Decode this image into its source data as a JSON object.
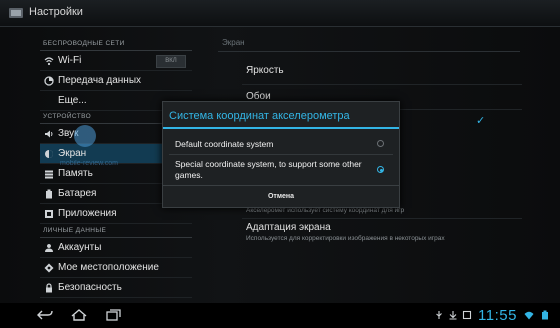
{
  "app": {
    "title": "Настройки"
  },
  "sidebar": {
    "category_wireless": "БЕСПРОВОДНЫЕ СЕТИ",
    "category_device": "УСТРОЙСТВО",
    "category_personal": "ЛИЧНЫЕ ДАННЫЕ",
    "wifi_toggle": "ВКЛ",
    "items": [
      {
        "label": "Wi-Fi",
        "icon": "wifi-icon"
      },
      {
        "label": "Передача данных",
        "icon": "data-usage-icon"
      },
      {
        "label": "Еще...",
        "icon": "more-icon"
      },
      {
        "label": "Звук",
        "icon": "sound-icon"
      },
      {
        "label": "Экран",
        "icon": "display-icon"
      },
      {
        "label": "Память",
        "icon": "storage-icon"
      },
      {
        "label": "Батарея",
        "icon": "battery-icon"
      },
      {
        "label": "Приложения",
        "icon": "apps-icon"
      },
      {
        "label": "Аккаунты",
        "icon": "accounts-icon"
      },
      {
        "label": "Мое местоположение",
        "icon": "location-icon"
      },
      {
        "label": "Безопасность",
        "icon": "security-icon"
      }
    ]
  },
  "main": {
    "section_title": "Экран",
    "items": [
      {
        "label": "Яркость"
      },
      {
        "label": "Обои"
      }
    ],
    "accelerometer_summary": "Акселеромет использует систему координат для игр",
    "screen_adaptation": {
      "label": "Адаптация экрана",
      "summary": "Используется для корректировки изображения в некоторых играх"
    }
  },
  "dialog": {
    "title": "Система координат акселерометра",
    "options": [
      {
        "label": "Default coordinate system",
        "selected": false
      },
      {
        "label": "Special coordinate system, to support some other games.",
        "selected": true
      }
    ],
    "cancel_label": "Отмена"
  },
  "watermark": {
    "text": "mobile-review.com"
  },
  "statusbar": {
    "time": "11:55"
  },
  "colors": {
    "accent": "#33b5e5",
    "active_item": "#123b52"
  }
}
